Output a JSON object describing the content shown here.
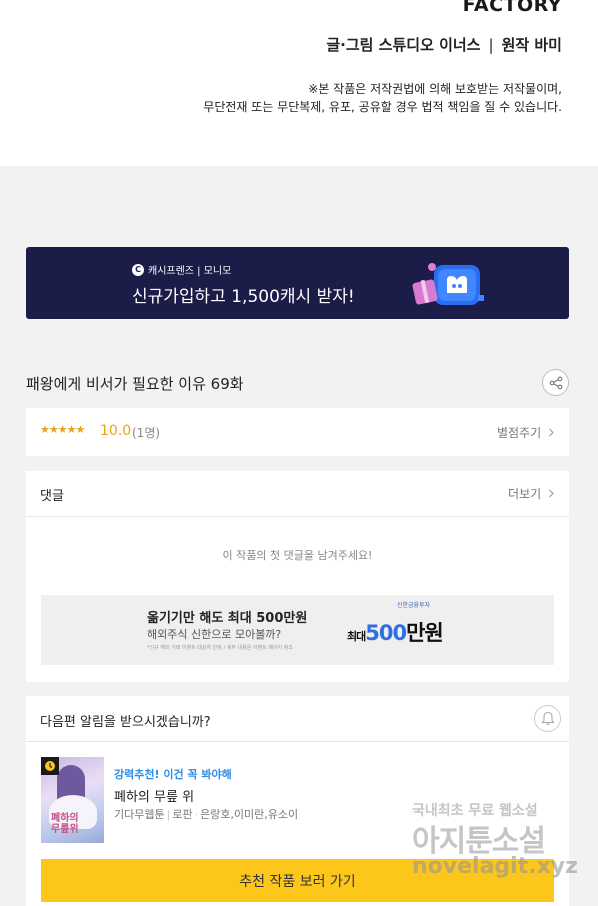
{
  "header": {
    "studio_logo": "FACTORY",
    "credits_art": "글·그림 스튜디오 이너스",
    "credits_separator": "|",
    "credits_original": "원작 바미",
    "copyright_line1": "※본 작품은 저작권법에 의해 보호받는 저작물이며,",
    "copyright_line2": "무단전재 또는 무단복제, 유포, 공유할 경우 법적 책임을 질 수 있습니다."
  },
  "banner": {
    "brand": "캐시프렌즈 | 모니모",
    "brand_icon_letter": "C",
    "headline": "신규가입하고 1,500캐시 받자!",
    "bg_color": "#1c1c48"
  },
  "episode": {
    "title": "패왕에게 비서가 필요한 이유  69화",
    "share_icon": "share-icon"
  },
  "rating": {
    "stars": "★★★★★",
    "score": "10.0",
    "count": "(1명)",
    "give_label": "별점주기",
    "star_color": "#e8a317"
  },
  "comments": {
    "label": "댓글",
    "more_label": "더보기",
    "empty_text": "이 작품의 첫 댓글을 남겨주세요!"
  },
  "ad": {
    "line1": "옮기기만 해도 최대 500만원",
    "line2": "해외주식 신한으로 모아볼까?",
    "line3": "*신규 해외 거래 이벤트 대상자 한정 / 세부 내용은 이벤트 페이지 참조",
    "sponsor": "신한금융투자",
    "big_prefix": "최대",
    "big_amount": "500",
    "big_suffix": "만원"
  },
  "notify": {
    "question": "다음편 알림을 받으시겠습니까?",
    "recommend_label": "강력추천! 이건 꼭 봐야해",
    "work_title": "폐하의 무릎 위",
    "thumb_title_line1": "폐하의",
    "thumb_title_line2": "무릎위",
    "meta_type": "기다무웹툰",
    "meta_genre": "로판",
    "meta_authors": "은랑호,이미란,유소이",
    "cta_label": "추천 작품 보러 가기",
    "cta_color": "#fcc61b",
    "recommend_color": "#2e8de6"
  },
  "watermark": {
    "line1": "국내최초 무료 웹소설",
    "line2": "아지툰소설",
    "line3": "novelagit.xyz"
  }
}
